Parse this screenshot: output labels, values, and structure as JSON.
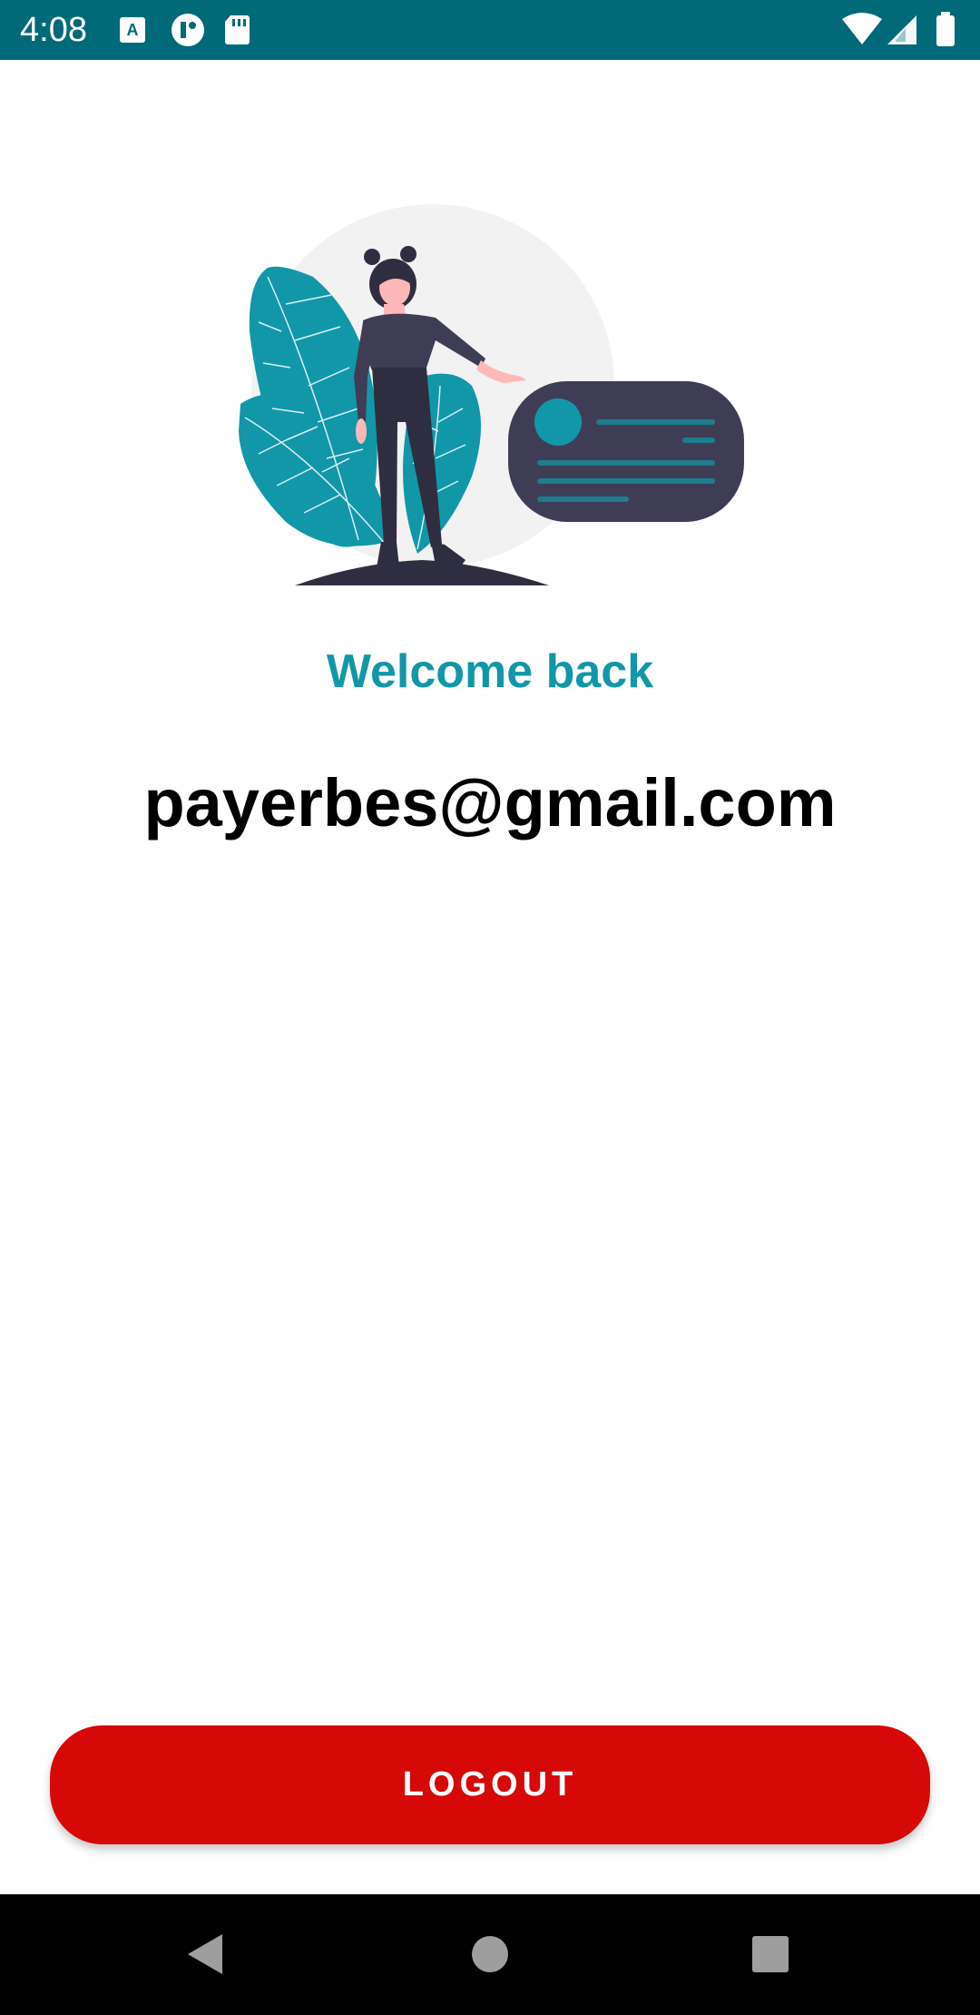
{
  "status_bar": {
    "time": "4:08",
    "left_icons": [
      "keyboard-a-icon",
      "app-notification-icon",
      "sd-card-icon"
    ],
    "right_icons": [
      "wifi-icon",
      "cell-signal-icon",
      "battery-icon"
    ],
    "background": "#006a79"
  },
  "main": {
    "welcome_text": "Welcome back",
    "email": "payerbes@gmail.com",
    "accent_color": "#1197a8",
    "illustration": "woman-presenting-card-illustration"
  },
  "actions": {
    "logout_label": "LOGOUT",
    "logout_color": "#d60808"
  },
  "nav_bar": {
    "buttons": [
      "back-icon",
      "home-icon",
      "recents-icon"
    ]
  }
}
